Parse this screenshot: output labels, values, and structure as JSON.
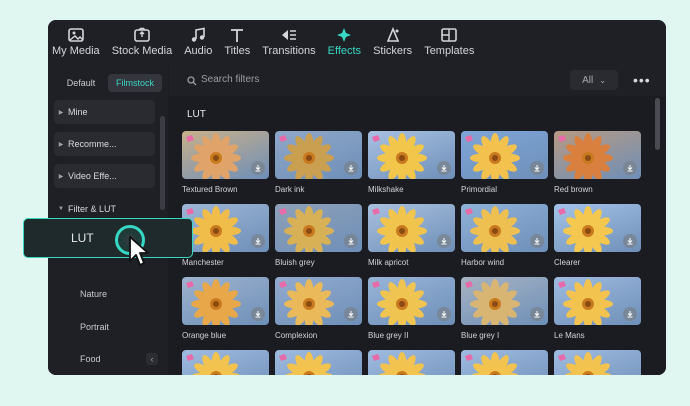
{
  "nav": {
    "tabs": [
      {
        "label": "My Media",
        "icon": "media-icon"
      },
      {
        "label": "Stock Media",
        "icon": "stock-icon"
      },
      {
        "label": "Audio",
        "icon": "music-note-icon"
      },
      {
        "label": "Titles",
        "icon": "text-icon"
      },
      {
        "label": "Transitions",
        "icon": "transition-icon"
      },
      {
        "label": "Effects",
        "icon": "sparkle-icon",
        "active": true
      },
      {
        "label": "Stickers",
        "icon": "sticker-icon"
      },
      {
        "label": "Templates",
        "icon": "template-icon"
      }
    ]
  },
  "sidebar": {
    "segments": [
      "Default",
      "Filmstock"
    ],
    "active_segment": "Filmstock",
    "items": [
      "Mine",
      "Recomme...",
      "Video Effe...",
      "Filter & LUT"
    ],
    "subitems": [
      "LUT",
      "Nature",
      "Portrait",
      "Food"
    ]
  },
  "search": {
    "placeholder": "Search filters",
    "filter_value": "All"
  },
  "section_title": "LUT",
  "filters": [
    "Textured Brown",
    "Dark ink",
    "Milkshake",
    "Primordial",
    "Red brown",
    "Manchester",
    "Bluish grey",
    "Milk apricot",
    "Harbor wind",
    "Clearer",
    "Orange blue",
    "Complexion",
    "Blue grey II",
    "Blue grey I",
    "Le Mans",
    "",
    "",
    "",
    "",
    ""
  ],
  "colors": {
    "accent": "#36d7c3",
    "background": "#1b1c21",
    "panel": "#1f2025"
  }
}
